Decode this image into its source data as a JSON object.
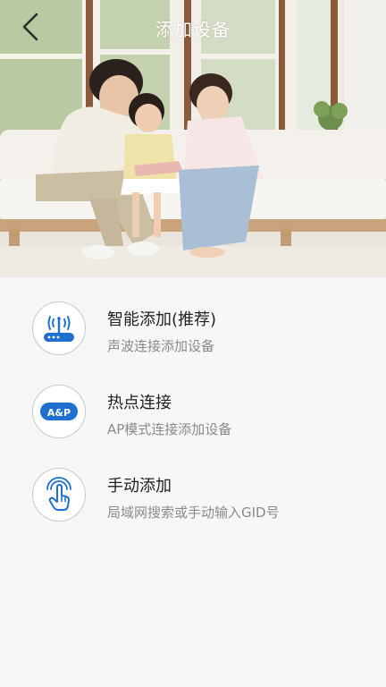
{
  "header": {
    "title": "添加设备",
    "back_icon": "chevron-left-icon"
  },
  "colors": {
    "accent": "#1e6fd0",
    "background": "#f7f7f7",
    "title_text": "#222222",
    "desc_text": "#8a8a8a"
  },
  "options": [
    {
      "icon": "router-signal-icon",
      "title": "智能添加(推荐)",
      "description": "声波连接添加设备"
    },
    {
      "icon": "ap-badge-icon",
      "icon_text": "A&P",
      "title": "热点连接",
      "description": "AP模式连接添加设备"
    },
    {
      "icon": "tap-hand-icon",
      "title": "手动添加",
      "description": "局域网搜索或手动输入GID号"
    }
  ]
}
